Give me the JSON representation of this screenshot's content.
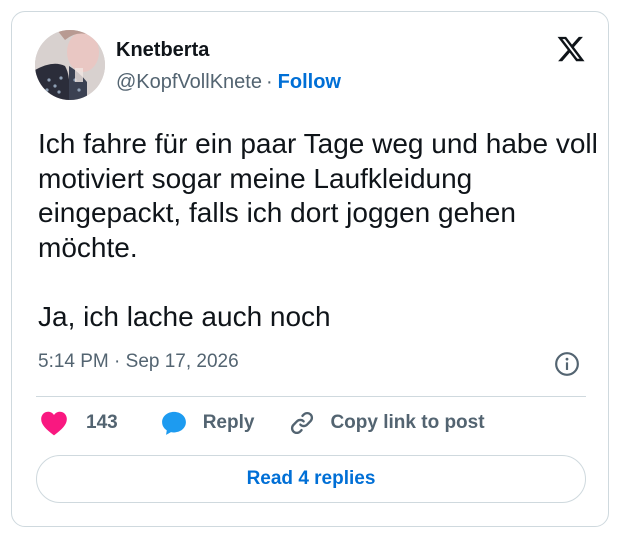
{
  "author": {
    "display_name": "Knetberta",
    "handle": "@KopfVollKnete",
    "separator": "·",
    "follow_label": "Follow"
  },
  "tweet": {
    "text": "Ich fahre für ein paar Tage weg und habe voll motiviert sogar meine Laufkleidung eingepackt, falls ich dort joggen gehen möchte.\n\nJa, ich lache auch noch",
    "timestamp": "5:14 PM · Sep 17, 2026"
  },
  "actions": {
    "like_count": "143",
    "reply_label": "Reply",
    "copy_label": "Copy link to post"
  },
  "read_replies_label": "Read 4 replies",
  "icons": {
    "logo": "x-logo-icon",
    "info": "info-icon",
    "like": "heart-icon",
    "reply": "speech-bubble-icon",
    "copy": "link-icon"
  },
  "colors": {
    "heart": "#f91880",
    "reply_bubble": "#1d9bf0",
    "link_blue": "#006fd6",
    "muted_text": "#536471",
    "border": "#cfd9de"
  }
}
